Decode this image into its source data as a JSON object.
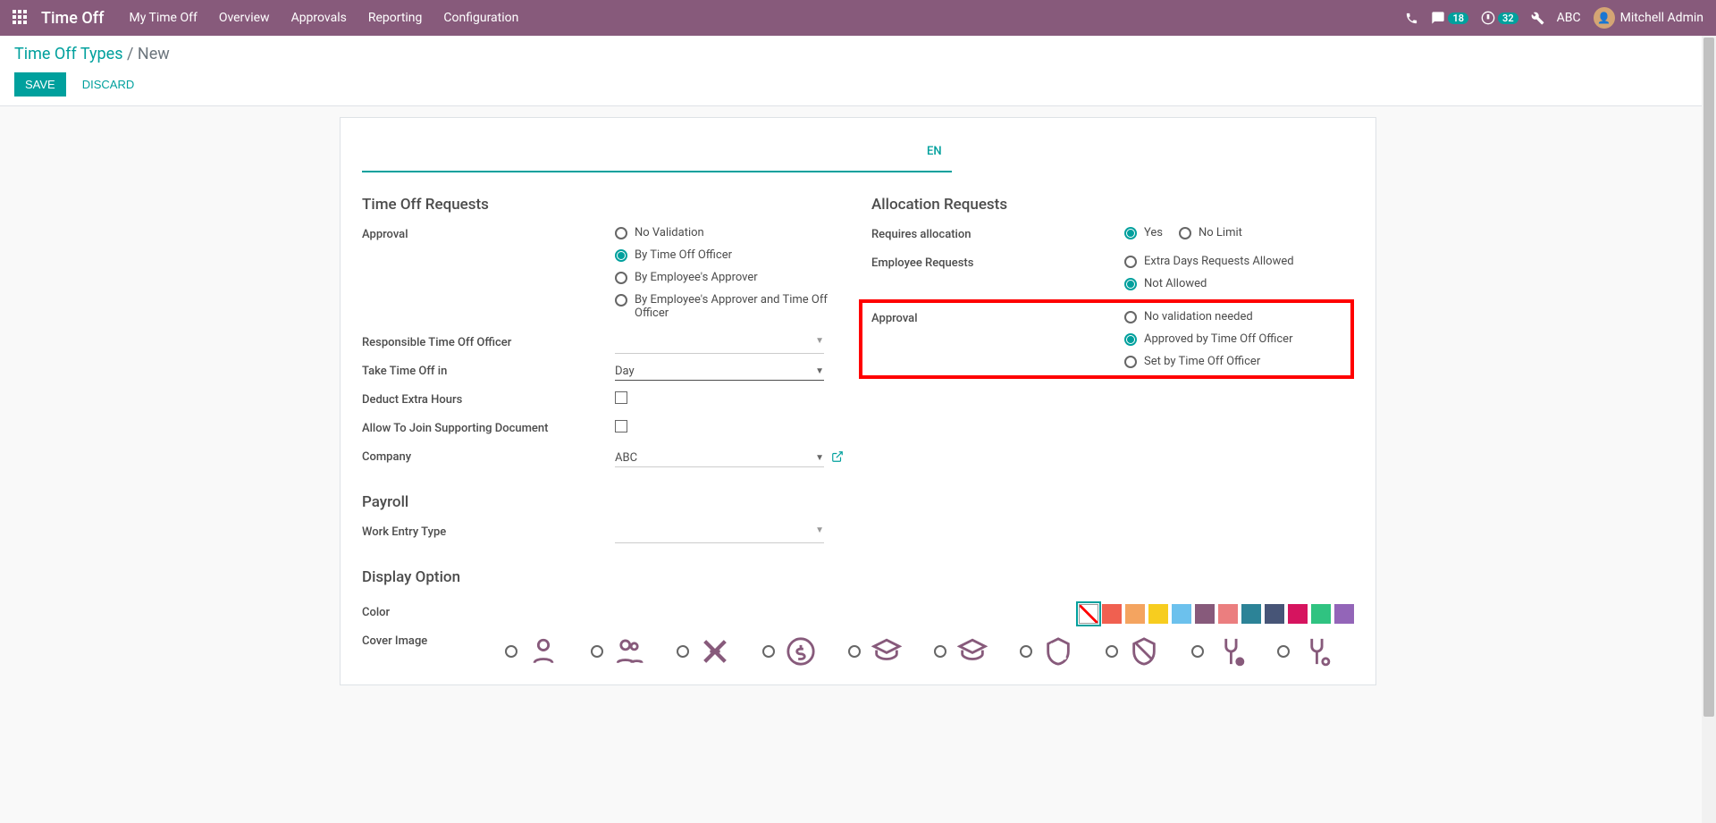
{
  "navbar": {
    "app_name": "Time Off",
    "menu": [
      "My Time Off",
      "Overview",
      "Approvals",
      "Reporting",
      "Configuration"
    ],
    "messages_badge": "18",
    "activities_badge": "32",
    "company_short": "ABC",
    "user_name": "Mitchell Admin"
  },
  "breadcrumb": {
    "parent": "Time Off Types",
    "current": "New"
  },
  "buttons": {
    "save": "SAVE",
    "discard": "DISCARD"
  },
  "title": {
    "value": "",
    "lang": "EN"
  },
  "left": {
    "section_requests": "Time Off Requests",
    "approval_label": "Approval",
    "approval_options": [
      "No Validation",
      "By Time Off Officer",
      "By Employee's Approver",
      "By Employee's Approver and Time Off Officer"
    ],
    "responsible_label": "Responsible Time Off Officer",
    "take_in_label": "Take Time Off in",
    "take_in_value": "Day",
    "deduct_label": "Deduct Extra Hours",
    "allow_doc_label": "Allow To Join Supporting Document",
    "company_label": "Company",
    "company_value": "ABC",
    "section_payroll": "Payroll",
    "work_entry_label": "Work Entry Type",
    "section_display": "Display Option",
    "color_label": "Color",
    "cover_label": "Cover Image"
  },
  "right": {
    "section_alloc": "Allocation Requests",
    "requires_label": "Requires allocation",
    "requires_options": [
      "Yes",
      "No Limit"
    ],
    "emp_req_label": "Employee Requests",
    "emp_req_options": [
      "Extra Days Requests Allowed",
      "Not Allowed"
    ],
    "approval_label": "Approval",
    "approval_options": [
      "No validation needed",
      "Approved by Time Off Officer",
      "Set by Time Off Officer"
    ]
  },
  "colors": [
    "none",
    "#f06050",
    "#f4a460",
    "#f7cd1f",
    "#6cc1ed",
    "#875a7b",
    "#eb7e7f",
    "#2c8397",
    "#475577",
    "#d6145f",
    "#30c381",
    "#9365b8"
  ]
}
